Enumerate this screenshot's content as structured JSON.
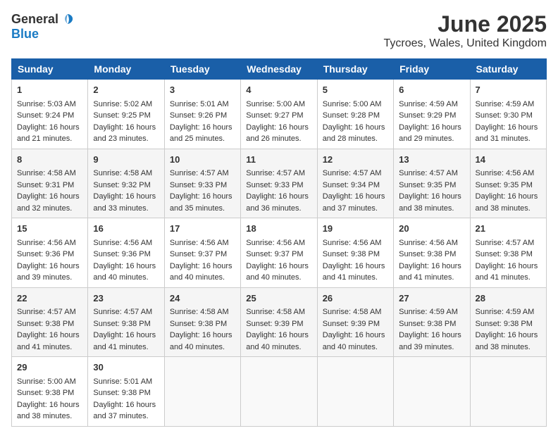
{
  "header": {
    "logo_general": "General",
    "logo_blue": "Blue",
    "month_title": "June 2025",
    "location": "Tycroes, Wales, United Kingdom"
  },
  "calendar": {
    "days_of_week": [
      "Sunday",
      "Monday",
      "Tuesday",
      "Wednesday",
      "Thursday",
      "Friday",
      "Saturday"
    ],
    "weeks": [
      [
        null,
        null,
        null,
        null,
        null,
        null,
        null
      ]
    ],
    "cells": [
      {
        "day": null,
        "content": null
      },
      {
        "day": null,
        "content": null
      },
      {
        "day": null,
        "content": null
      },
      {
        "day": null,
        "content": null
      },
      {
        "day": null,
        "content": null
      },
      {
        "day": null,
        "content": null
      },
      {
        "day": null,
        "content": null
      }
    ],
    "rows": [
      [
        {
          "day": "1",
          "sunrise": "Sunrise: 5:03 AM",
          "sunset": "Sunset: 9:24 PM",
          "daylight": "Daylight: 16 hours and 21 minutes."
        },
        {
          "day": "2",
          "sunrise": "Sunrise: 5:02 AM",
          "sunset": "Sunset: 9:25 PM",
          "daylight": "Daylight: 16 hours and 23 minutes."
        },
        {
          "day": "3",
          "sunrise": "Sunrise: 5:01 AM",
          "sunset": "Sunset: 9:26 PM",
          "daylight": "Daylight: 16 hours and 25 minutes."
        },
        {
          "day": "4",
          "sunrise": "Sunrise: 5:00 AM",
          "sunset": "Sunset: 9:27 PM",
          "daylight": "Daylight: 16 hours and 26 minutes."
        },
        {
          "day": "5",
          "sunrise": "Sunrise: 5:00 AM",
          "sunset": "Sunset: 9:28 PM",
          "daylight": "Daylight: 16 hours and 28 minutes."
        },
        {
          "day": "6",
          "sunrise": "Sunrise: 4:59 AM",
          "sunset": "Sunset: 9:29 PM",
          "daylight": "Daylight: 16 hours and 29 minutes."
        },
        {
          "day": "7",
          "sunrise": "Sunrise: 4:59 AM",
          "sunset": "Sunset: 9:30 PM",
          "daylight": "Daylight: 16 hours and 31 minutes."
        }
      ],
      [
        {
          "day": "8",
          "sunrise": "Sunrise: 4:58 AM",
          "sunset": "Sunset: 9:31 PM",
          "daylight": "Daylight: 16 hours and 32 minutes."
        },
        {
          "day": "9",
          "sunrise": "Sunrise: 4:58 AM",
          "sunset": "Sunset: 9:32 PM",
          "daylight": "Daylight: 16 hours and 33 minutes."
        },
        {
          "day": "10",
          "sunrise": "Sunrise: 4:57 AM",
          "sunset": "Sunset: 9:33 PM",
          "daylight": "Daylight: 16 hours and 35 minutes."
        },
        {
          "day": "11",
          "sunrise": "Sunrise: 4:57 AM",
          "sunset": "Sunset: 9:33 PM",
          "daylight": "Daylight: 16 hours and 36 minutes."
        },
        {
          "day": "12",
          "sunrise": "Sunrise: 4:57 AM",
          "sunset": "Sunset: 9:34 PM",
          "daylight": "Daylight: 16 hours and 37 minutes."
        },
        {
          "day": "13",
          "sunrise": "Sunrise: 4:57 AM",
          "sunset": "Sunset: 9:35 PM",
          "daylight": "Daylight: 16 hours and 38 minutes."
        },
        {
          "day": "14",
          "sunrise": "Sunrise: 4:56 AM",
          "sunset": "Sunset: 9:35 PM",
          "daylight": "Daylight: 16 hours and 38 minutes."
        }
      ],
      [
        {
          "day": "15",
          "sunrise": "Sunrise: 4:56 AM",
          "sunset": "Sunset: 9:36 PM",
          "daylight": "Daylight: 16 hours and 39 minutes."
        },
        {
          "day": "16",
          "sunrise": "Sunrise: 4:56 AM",
          "sunset": "Sunset: 9:36 PM",
          "daylight": "Daylight: 16 hours and 40 minutes."
        },
        {
          "day": "17",
          "sunrise": "Sunrise: 4:56 AM",
          "sunset": "Sunset: 9:37 PM",
          "daylight": "Daylight: 16 hours and 40 minutes."
        },
        {
          "day": "18",
          "sunrise": "Sunrise: 4:56 AM",
          "sunset": "Sunset: 9:37 PM",
          "daylight": "Daylight: 16 hours and 40 minutes."
        },
        {
          "day": "19",
          "sunrise": "Sunrise: 4:56 AM",
          "sunset": "Sunset: 9:38 PM",
          "daylight": "Daylight: 16 hours and 41 minutes."
        },
        {
          "day": "20",
          "sunrise": "Sunrise: 4:56 AM",
          "sunset": "Sunset: 9:38 PM",
          "daylight": "Daylight: 16 hours and 41 minutes."
        },
        {
          "day": "21",
          "sunrise": "Sunrise: 4:57 AM",
          "sunset": "Sunset: 9:38 PM",
          "daylight": "Daylight: 16 hours and 41 minutes."
        }
      ],
      [
        {
          "day": "22",
          "sunrise": "Sunrise: 4:57 AM",
          "sunset": "Sunset: 9:38 PM",
          "daylight": "Daylight: 16 hours and 41 minutes."
        },
        {
          "day": "23",
          "sunrise": "Sunrise: 4:57 AM",
          "sunset": "Sunset: 9:38 PM",
          "daylight": "Daylight: 16 hours and 41 minutes."
        },
        {
          "day": "24",
          "sunrise": "Sunrise: 4:58 AM",
          "sunset": "Sunset: 9:38 PM",
          "daylight": "Daylight: 16 hours and 40 minutes."
        },
        {
          "day": "25",
          "sunrise": "Sunrise: 4:58 AM",
          "sunset": "Sunset: 9:39 PM",
          "daylight": "Daylight: 16 hours and 40 minutes."
        },
        {
          "day": "26",
          "sunrise": "Sunrise: 4:58 AM",
          "sunset": "Sunset: 9:39 PM",
          "daylight": "Daylight: 16 hours and 40 minutes."
        },
        {
          "day": "27",
          "sunrise": "Sunrise: 4:59 AM",
          "sunset": "Sunset: 9:38 PM",
          "daylight": "Daylight: 16 hours and 39 minutes."
        },
        {
          "day": "28",
          "sunrise": "Sunrise: 4:59 AM",
          "sunset": "Sunset: 9:38 PM",
          "daylight": "Daylight: 16 hours and 38 minutes."
        }
      ],
      [
        {
          "day": "29",
          "sunrise": "Sunrise: 5:00 AM",
          "sunset": "Sunset: 9:38 PM",
          "daylight": "Daylight: 16 hours and 38 minutes."
        },
        {
          "day": "30",
          "sunrise": "Sunrise: 5:01 AM",
          "sunset": "Sunset: 9:38 PM",
          "daylight": "Daylight: 16 hours and 37 minutes."
        },
        null,
        null,
        null,
        null,
        null
      ]
    ]
  }
}
